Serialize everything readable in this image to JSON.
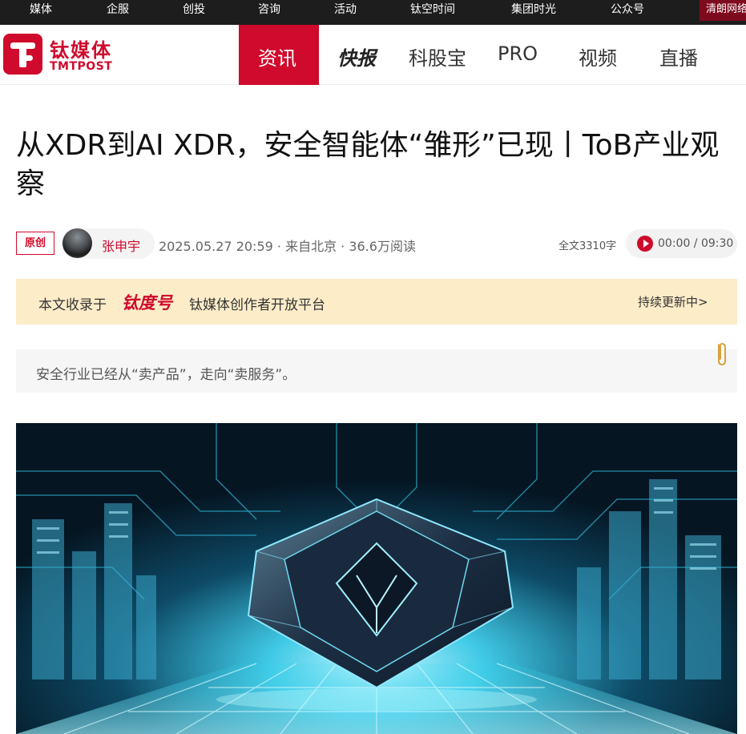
{
  "topbar": {
    "items": [
      "媒体",
      "企服",
      "创投",
      "咨询",
      "活动",
      "钛空时间",
      "集团时光",
      "公众号"
    ],
    "promo": "清朗网络"
  },
  "logo": {
    "cn": "钛媒体",
    "en": "TMTPOST"
  },
  "nav": {
    "items": [
      "资讯",
      "快报",
      "科股宝",
      "PRO",
      "视频",
      "直播"
    ],
    "active": "资讯"
  },
  "article": {
    "title": "从XDR到AI XDR，安全智能体“雏形”已现丨ToB产业观察",
    "badge": "原创",
    "author": "张申宇",
    "meta": "2025.05.27 20:59 · 来自北京 · 36.6万阅读",
    "word_count": "全文3310字",
    "audio_time": "00:00 / 09:30",
    "summary": "安全行业已经从“卖产品”，走向“卖服务”。"
  },
  "banner": {
    "prefix": "本文收录于",
    "brand": "钛度号",
    "suffix": "钛媒体创作者开放平台",
    "more": "持续更新中>"
  },
  "colors": {
    "brand_red": "#cf0a2c",
    "topbar_bg": "#1d1d1d",
    "banner_bg": "#fdecc8"
  }
}
